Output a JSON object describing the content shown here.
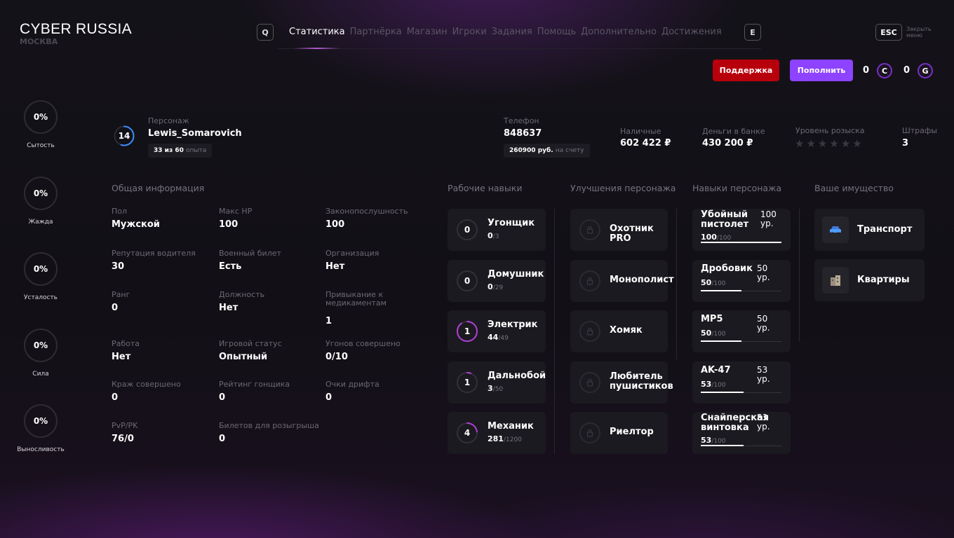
{
  "header": {
    "logo": "CYBER RUSSIA",
    "city": "МОСКВА",
    "key_q": "Q",
    "key_e": "E",
    "esc": "ESC",
    "esc_label": "Закрыть меню"
  },
  "nav": [
    "Статистика",
    "Партнёрка",
    "Магазин",
    "Игроки",
    "Задания",
    "Помощь",
    "Дополнительно",
    "Достижения"
  ],
  "actions": {
    "support": "Поддержка",
    "topup": "Пополнить",
    "c_value": "0",
    "c_icon": "C",
    "g_value": "0",
    "g_icon": "G"
  },
  "needs": [
    {
      "value": "0%",
      "label": "Сытость"
    },
    {
      "value": "0%",
      "label": "Жажда"
    },
    {
      "value": "0%",
      "label": "Усталость"
    },
    {
      "value": "0%",
      "label": "Сила"
    },
    {
      "value": "0%",
      "label": "Выносливость"
    }
  ],
  "profile": {
    "level": "14",
    "level_progress": 0.55,
    "char_label": "Персонаж",
    "char_name": "Lewis_Somarovich",
    "exp_value": "33 из 60",
    "exp_unit": "опыта",
    "phone_label": "Телефон",
    "phone": "848637",
    "phone_balance": "260900 руб.",
    "phone_balance_unit": "на счету",
    "cash_label": "Наличные",
    "cash": "602 422 ₽",
    "bank_label": "Деньги в банке",
    "bank": "430 200 ₽",
    "wanted_label": "Уровень розыска",
    "wanted_stars": 0,
    "wanted_max": 6,
    "fines_label": "Штрафы",
    "fines": "3"
  },
  "sections": {
    "general": "Общая информация",
    "work": "Рабочие навыки",
    "upgrades": "Улучшения персонажа",
    "skills": "Навыки персонажа",
    "property": "Ваше имущество"
  },
  "general": [
    {
      "label": "Пол",
      "value": "Мужской"
    },
    {
      "label": "Макс HP",
      "value": "100"
    },
    {
      "label": "Законопослушность",
      "value": "100"
    },
    {
      "label": "Репутация водителя",
      "value": "30"
    },
    {
      "label": "Военный билет",
      "value": "Есть"
    },
    {
      "label": "Организация",
      "value": "Нет"
    },
    {
      "label": "Ранг",
      "value": "0"
    },
    {
      "label": "Должность",
      "value": "Нет"
    },
    {
      "label": "Привыкание к медикаментам",
      "value": "1"
    },
    {
      "label": "Работа",
      "value": "Нет"
    },
    {
      "label": "Игровой статус",
      "value": "Опытный"
    },
    {
      "label": "Угонов совершено",
      "value": "0/10"
    },
    {
      "label": "Краж совершено",
      "value": "0"
    },
    {
      "label": "Рейтинг гонщика",
      "value": "0"
    },
    {
      "label": "Очки дрифта",
      "value": "0"
    },
    {
      "label": "PvP/PK",
      "value": "76/0"
    },
    {
      "label": "Билетов для розыгрыша",
      "value": "0"
    }
  ],
  "work": [
    {
      "level": "0",
      "name": "Угонщик",
      "cur": "0",
      "max": "/3",
      "progress": 0
    },
    {
      "level": "0",
      "name": "Домушник",
      "cur": "0",
      "max": "/29",
      "progress": 0
    },
    {
      "level": "1",
      "name": "Электрик",
      "cur": "44",
      "max": "/49",
      "progress": 0.9
    },
    {
      "level": "1",
      "name": "Дальнобой",
      "cur": "3",
      "max": "/50",
      "progress": 0.06
    },
    {
      "level": "4",
      "name": "Механик",
      "cur": "281",
      "max": "/1200",
      "progress": 0.23
    }
  ],
  "upgrades": [
    "Охотник PRO",
    "Монополист",
    "Хомяк",
    "Любитель пушистиков",
    "Риелтор"
  ],
  "skills": [
    {
      "name": "Убойный пистолет",
      "level": "100 ур.",
      "cur": "100",
      "max": "/100",
      "progress": 1.0
    },
    {
      "name": "Дробовик",
      "level": "50 ур.",
      "cur": "50",
      "max": "/100",
      "progress": 0.5
    },
    {
      "name": "MP5",
      "level": "50 ур.",
      "cur": "50",
      "max": "/100",
      "progress": 0.5
    },
    {
      "name": "AK-47",
      "level": "53 ур.",
      "cur": "53",
      "max": "/100",
      "progress": 0.53
    },
    {
      "name": "Снайперская винтовка",
      "level": "53 ур.",
      "cur": "53",
      "max": "/100",
      "progress": 0.53
    }
  ],
  "property": [
    {
      "name": "Транспорт",
      "icon": "car-icon"
    },
    {
      "name": "Квартиры",
      "icon": "building-icon"
    }
  ],
  "colors": {
    "accent": "#8d43ff",
    "support": "#b8000c",
    "ring_active": "#b03fd6",
    "level_ring": "#3d8cff"
  }
}
